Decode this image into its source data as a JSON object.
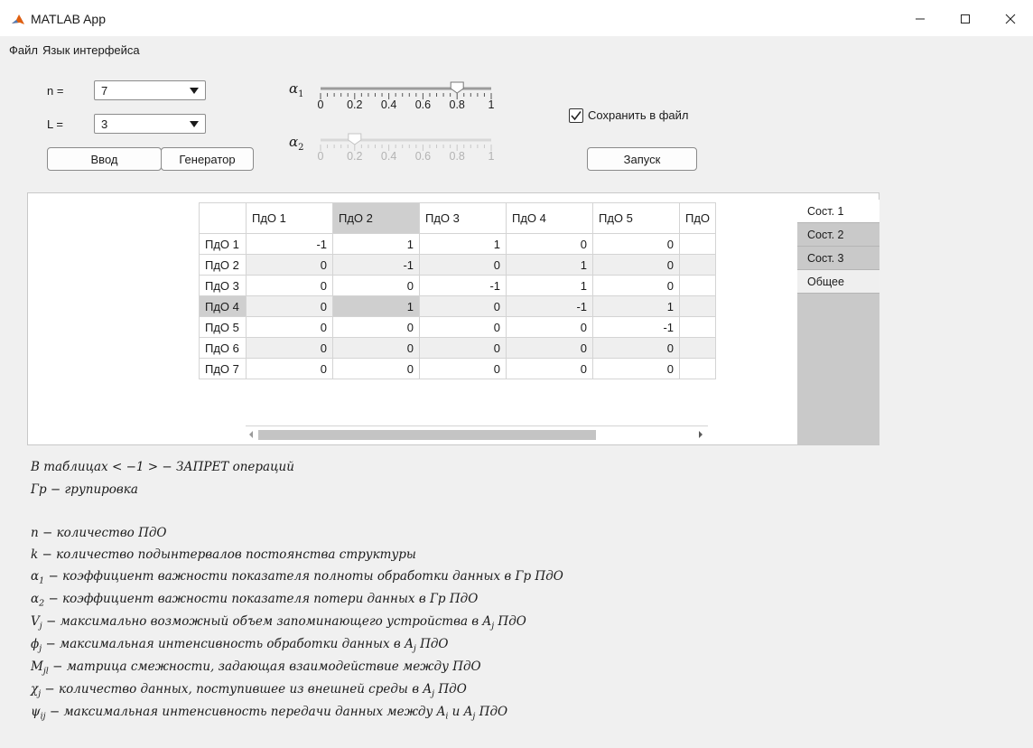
{
  "window": {
    "title": "MATLAB App",
    "icon": "matlab-icon",
    "controls": [
      "minimize-icon",
      "maximize-icon",
      "close-icon"
    ]
  },
  "menu": {
    "file": "Файл",
    "language": "Язык интерфейса"
  },
  "controls": {
    "n_label": "n =",
    "n_value": "7",
    "l_label": "L =",
    "l_value": "3",
    "input_button": "Ввод",
    "generator_button": "Генератор",
    "save_checkbox_label": "Сохранить в файл",
    "save_checked": true,
    "run_button": "Запуск"
  },
  "sliders": {
    "alpha1": {
      "label": "α",
      "sub": "1",
      "value": 0.8,
      "enabled": true,
      "ticks": [
        "0",
        "0.2",
        "0.4",
        "0.6",
        "0.8",
        "1"
      ]
    },
    "alpha2": {
      "label": "α",
      "sub": "2",
      "value": 0.2,
      "enabled": false,
      "ticks": [
        "0",
        "0.2",
        "0.4",
        "0.6",
        "0.8",
        "1"
      ]
    }
  },
  "table": {
    "columns": [
      "ПдО 1",
      "ПдО 2",
      "ПдО 3",
      "ПдО 4",
      "ПдО 5",
      "ПдО"
    ],
    "rows": [
      {
        "label": "ПдО 1",
        "values": [
          "-1",
          "1",
          "1",
          "0",
          "0",
          ""
        ]
      },
      {
        "label": "ПдО 2",
        "values": [
          "0",
          "-1",
          "0",
          "1",
          "0",
          ""
        ]
      },
      {
        "label": "ПдО 3",
        "values": [
          "0",
          "0",
          "-1",
          "1",
          "0",
          ""
        ]
      },
      {
        "label": "ПдО 4",
        "values": [
          "0",
          "1",
          "0",
          "-1",
          "1",
          ""
        ]
      },
      {
        "label": "ПдО 5",
        "values": [
          "0",
          "0",
          "0",
          "0",
          "-1",
          ""
        ]
      },
      {
        "label": "ПдО 6",
        "values": [
          "0",
          "0",
          "0",
          "0",
          "0",
          ""
        ]
      },
      {
        "label": "ПдО 7",
        "values": [
          "0",
          "0",
          "0",
          "0",
          "0",
          ""
        ]
      }
    ]
  },
  "tabs": [
    "Сост. 1",
    "Сост. 2",
    "Сост. 3",
    "Общее"
  ],
  "notes": {
    "n1": "В таблицах  < −1 >  − ЗАПРЕТ операций",
    "n2": "Гр − групировка",
    "n3": "n − количество ПдО",
    "n4": "k − количество подынтервалов постоянства структуры",
    "n5_sym": "α",
    "n5_sub": "1",
    "n5": " − коэффициент важности показателя полноты обработки данных в Гр ПдО",
    "n6_sym": "α",
    "n6_sub": "2",
    "n6": " − коэффициент важности показателя потери данных в Гр ПдО",
    "n7_sym": "V",
    "n7_sub": "j",
    "n7a": " − максимально возможный объем запоминающего устройства в A",
    "n7_sub2": "j",
    "n7b": " ПдО",
    "n8_sym": "ϕ",
    "n8_sub": "j",
    "n8a": " − максимальная интенсивность обработки данных в A",
    "n8_sub2": "j",
    "n8b": " ПдО",
    "n9_sym": "M",
    "n9_sub": "jl",
    "n9": " − матрица смежности, задающая взаимодействие между ПдО",
    "n10_sym": "χ",
    "n10_sub": "j",
    "n10a": " − количество данных, поступившее из внешней среды в A",
    "n10_sub2": "j",
    "n10b": " ПдО",
    "n11_sym": "ψ",
    "n11_sub": "ij",
    "n11a": " − максимальная интенсивность передачи данных между A",
    "n11_sub2": "i",
    "n11b": " и A",
    "n11_sub3": "j",
    "n11c": " ПдО"
  }
}
